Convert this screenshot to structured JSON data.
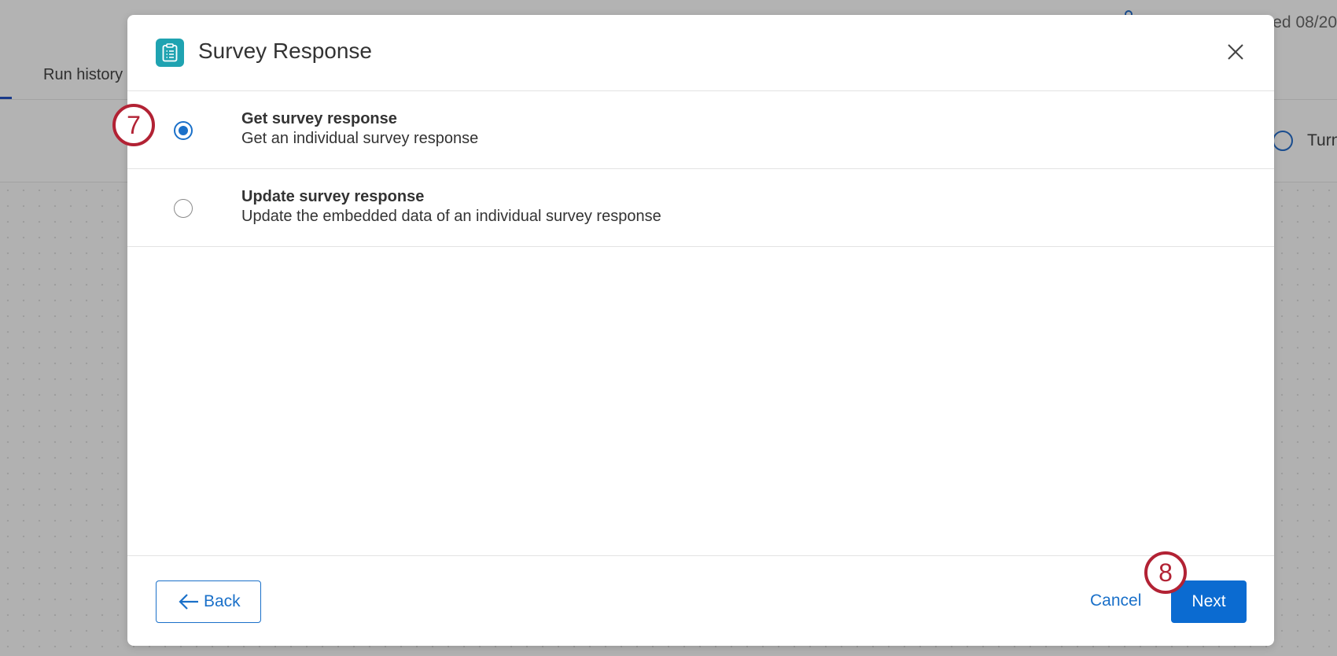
{
  "background": {
    "updated_text": "ed 08/20",
    "tab_label": "Run history",
    "toggle_label": "Turn"
  },
  "modal": {
    "icon": "clipboard-icon",
    "title": "Survey Response",
    "close_icon": "close-icon",
    "options": [
      {
        "title": "Get survey response",
        "description": "Get an individual survey response",
        "selected": true
      },
      {
        "title": "Update survey response",
        "description": "Update the embedded data of an individual survey response",
        "selected": false
      }
    ]
  },
  "footer": {
    "back_label": "Back",
    "cancel_label": "Cancel",
    "next_label": "Next"
  },
  "annotations": {
    "step_radio": "7",
    "step_next": "8"
  },
  "colors": {
    "accent": "#1a70c9",
    "primary_button": "#0b6bd1",
    "header_icon_bg": "#1fa3b1",
    "annotation": "#b22234",
    "overlay": "#b1b1b1"
  }
}
